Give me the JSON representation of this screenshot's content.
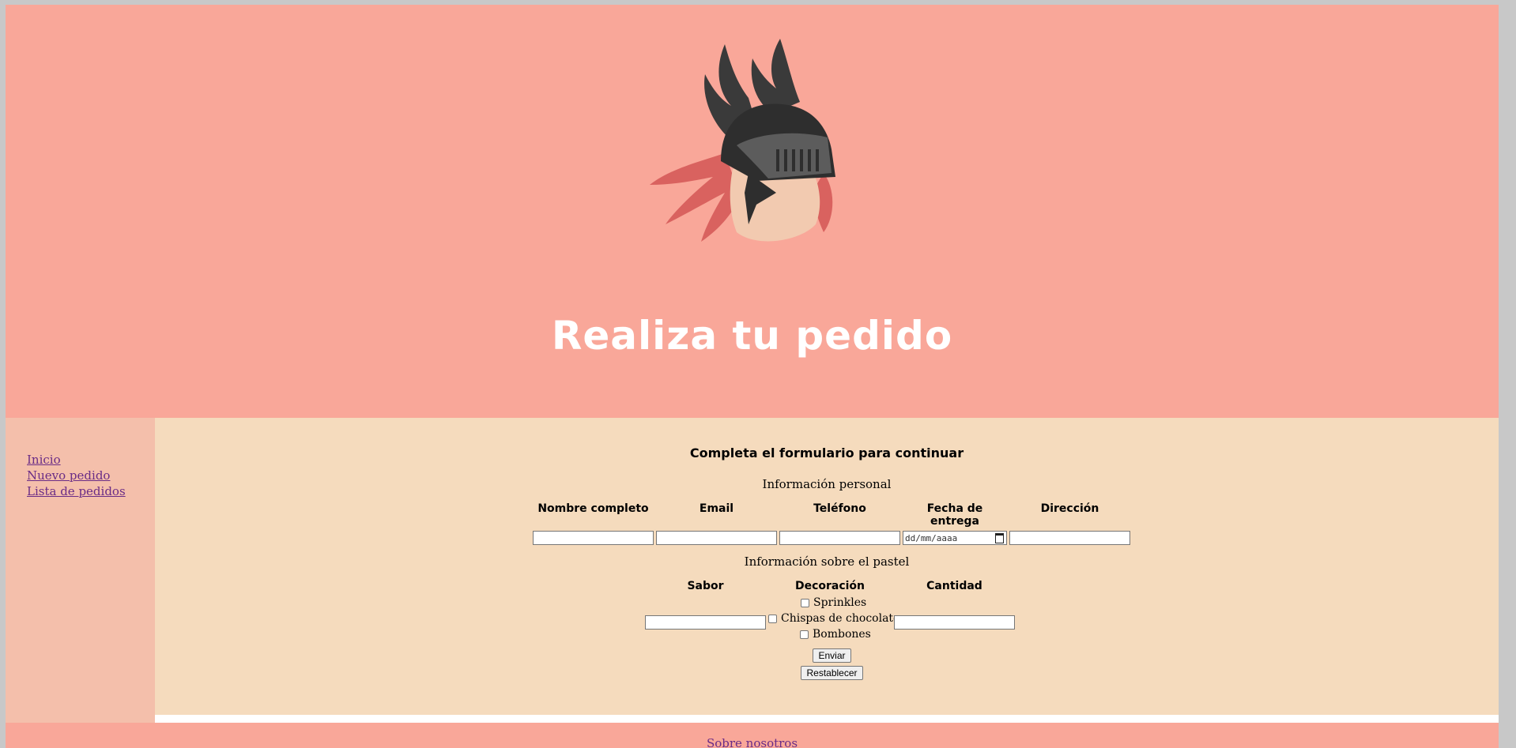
{
  "header": {
    "title": "Realiza tu pedido",
    "logo_icon": "winged-helmet-logo"
  },
  "nav": {
    "items": [
      "Inicio",
      "Nuevo pedido",
      "Lista de pedidos"
    ]
  },
  "form": {
    "heading": "Completa el formulario para continuar",
    "personal_section": "Información personal",
    "personal_columns": [
      "Nombre completo",
      "Email",
      "Teléfono",
      "Fecha de entrega",
      "Dirección"
    ],
    "date_placeholder": "dd/mm/aaaa",
    "cake_section": "Información sobre el pastel",
    "cake_columns": [
      "Sabor",
      "Decoración",
      "Cantidad"
    ],
    "decoration_options": [
      "Sprinkles",
      "Chispas de chocolate",
      "Bombones"
    ],
    "submit_label": "Enviar",
    "reset_label": "Restablecer"
  },
  "footer": {
    "link": "Sobre nosotros"
  },
  "colors": {
    "header_bg": "#f9a799",
    "sidebar_bg": "#f4bfab",
    "main_bg": "#f5dbbd",
    "link": "#6a2c86"
  }
}
